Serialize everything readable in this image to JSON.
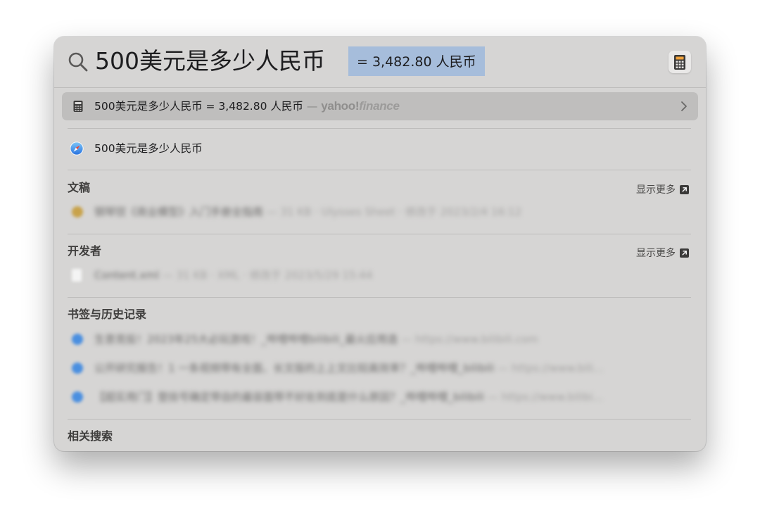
{
  "search": {
    "query": "500美元是多少人民币",
    "completion": "= 3,482.80 人民币"
  },
  "top_hit": {
    "text": "500美元是多少人民币 = 3,482.80 人民币",
    "separator": "—",
    "source_brand_main": "yahoo!",
    "source_brand_sub": "finance",
    "icon": "calculator-icon"
  },
  "web_suggestion": {
    "text": "500美元是多少人民币",
    "icon": "safari-compass-icon"
  },
  "sections": {
    "documents": {
      "title": "文稿",
      "show_more": "显示更多",
      "items": [
        {
          "title": "钢琴钗《商业模型》入门手册全指南",
          "meta": "— 31 KB · Ulysses Sheet · 修改于 2023/2/4 16:12"
        }
      ]
    },
    "developer": {
      "title": "开发者",
      "show_more": "显示更多",
      "items": [
        {
          "title": "Content.xml",
          "meta": "— 31 KB · XML · 修改于 2023/5/29 15:44"
        }
      ]
    },
    "bookmarks": {
      "title": "书签与历史记录",
      "items": [
        {
          "title": "生意竞投！2023年25大必玩游戏！_哔哩哔哩bilibili_最火应用造",
          "meta": "— https://www.bilibili.com"
        },
        {
          "title": "公开研究报告！1 一条视频带有全面、长文版的上上文比较高效率？_哔哩哔哩_bilibili",
          "meta": "— https://www.bili..."
        },
        {
          "title": "【超实用门】登技号确定带自的最容面带不好处到底是什么原因？_哔哩哔哩_bilibili",
          "meta": "— https://www.bilibi..."
        }
      ]
    },
    "related": {
      "title": "相关搜索"
    }
  },
  "colors": {
    "panel_bg": "#d6d5d4",
    "selected_row": "#bfbebd",
    "completion_highlight": "#a6bddb"
  }
}
